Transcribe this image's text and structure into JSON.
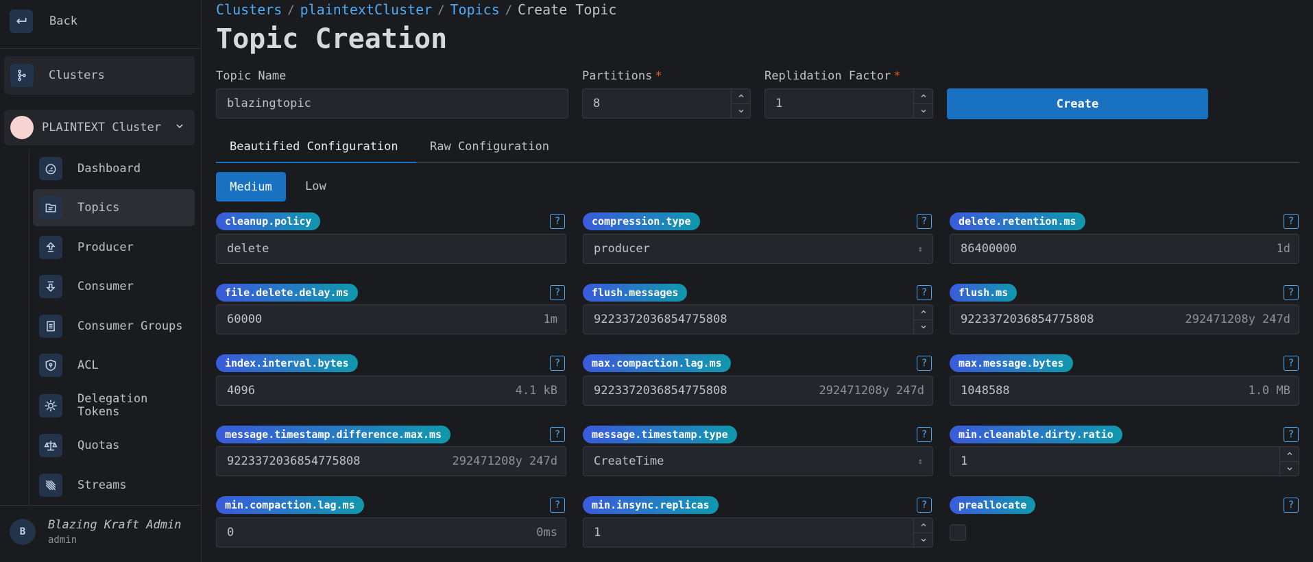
{
  "sidebar": {
    "back_label": "Back",
    "clusters_label": "Clusters",
    "cluster_name": "PLAINTEXT Cluster",
    "items": [
      {
        "label": "Dashboard",
        "icon": "gauge-icon"
      },
      {
        "label": "Topics",
        "icon": "topics-icon"
      },
      {
        "label": "Producer",
        "icon": "upload-icon"
      },
      {
        "label": "Consumer",
        "icon": "download-icon"
      },
      {
        "label": "Consumer Groups",
        "icon": "group-icon"
      },
      {
        "label": "ACL",
        "icon": "shield-icon"
      },
      {
        "label": "Delegation Tokens",
        "icon": "token-icon"
      },
      {
        "label": "Quotas",
        "icon": "scale-icon"
      },
      {
        "label": "Streams",
        "icon": "streams-icon"
      }
    ],
    "user": {
      "initial": "B",
      "name": "Blazing Kraft Admin",
      "role": "admin"
    }
  },
  "breadcrumb": {
    "clusters": "Clusters",
    "cluster": "plaintextCluster",
    "topics": "Topics",
    "current": "Create Topic"
  },
  "title": "Topic Creation",
  "form": {
    "topic_name_label": "Topic Name",
    "topic_name_value": "blazingtopic",
    "partitions_label": "Partitions",
    "partitions_value": "8",
    "replication_label": "Replidation Factor",
    "replication_value": "1",
    "required_mark": "*",
    "create_label": "Create"
  },
  "tabs": {
    "beautified": "Beautified Configuration",
    "raw": "Raw Configuration"
  },
  "segments": {
    "medium": "Medium",
    "low": "Low"
  },
  "help_glyph": "?",
  "configs": [
    {
      "key": "cleanup.policy",
      "value": "delete",
      "hint": ""
    },
    {
      "key": "compression.type",
      "value": "producer",
      "hint": ""
    },
    {
      "key": "delete.retention.ms",
      "value": "86400000",
      "hint": "1d"
    },
    {
      "key": "file.delete.delay.ms",
      "value": "60000",
      "hint": "1m"
    },
    {
      "key": "flush.messages",
      "value": "9223372036854775808",
      "hint": ""
    },
    {
      "key": "flush.ms",
      "value": "9223372036854775808",
      "hint": "292471208y 247d"
    },
    {
      "key": "index.interval.bytes",
      "value": "4096",
      "hint": "4.1 kB"
    },
    {
      "key": "max.compaction.lag.ms",
      "value": "9223372036854775808",
      "hint": "292471208y 247d"
    },
    {
      "key": "max.message.bytes",
      "value": "1048588",
      "hint": "1.0 MB"
    },
    {
      "key": "message.timestamp.difference.max.ms",
      "value": "9223372036854775808",
      "hint": "292471208y 247d"
    },
    {
      "key": "message.timestamp.type",
      "value": "CreateTime",
      "hint": ""
    },
    {
      "key": "min.cleanable.dirty.ratio",
      "value": "1",
      "hint": ""
    },
    {
      "key": "min.compaction.lag.ms",
      "value": "0",
      "hint": "0ms"
    },
    {
      "key": "min.insync.replicas",
      "value": "1",
      "hint": ""
    },
    {
      "key": "preallocate",
      "value": "",
      "hint": ""
    }
  ]
}
